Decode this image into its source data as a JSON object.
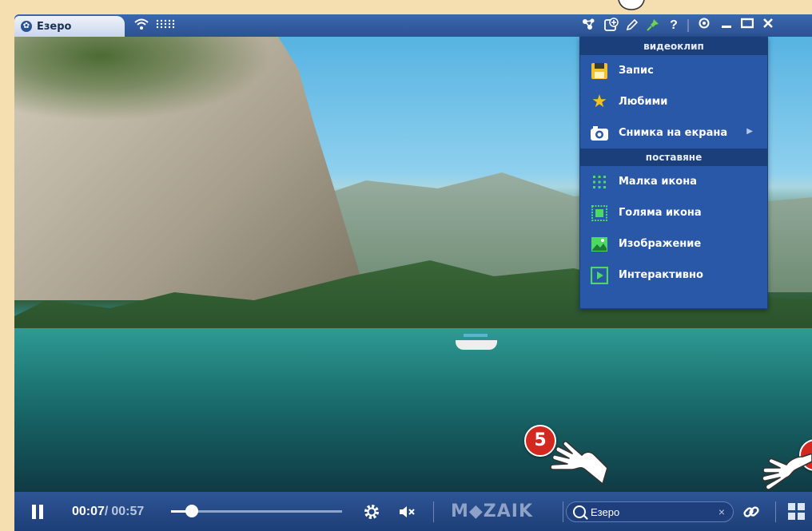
{
  "window": {
    "tab_title": "Езеро"
  },
  "titlebar_icons": [
    "molecule-icon",
    "add-resource-icon",
    "pencil-icon",
    "pin-icon",
    "help-icon",
    "eye-icon",
    "minimize-icon",
    "maximize-icon",
    "close-icon"
  ],
  "menu": {
    "section_video": "видеоклип",
    "section_embed": "поставяне",
    "items_video": [
      {
        "label": "Запис",
        "icon": "save-icon"
      },
      {
        "label": "Любими",
        "icon": "star-icon"
      },
      {
        "label": "Снимка на екрана",
        "icon": "camera-icon",
        "has_submenu": true
      }
    ],
    "items_embed": [
      {
        "label": "Малка икона",
        "icon": "small-icon-icon"
      },
      {
        "label": "Голяма икона",
        "icon": "large-icon-icon"
      },
      {
        "label": "Изображение",
        "icon": "image-icon"
      },
      {
        "label": "Интерактивно",
        "icon": "interactive-play-icon"
      }
    ]
  },
  "callouts": [
    {
      "number": "5"
    }
  ],
  "player": {
    "current_time": "00:07",
    "separator": "/",
    "total_time": "00:57",
    "progress": 0.12,
    "brand": "M◆ZAIK",
    "search_value": "Езеро",
    "search_clear": "×"
  },
  "colors": {
    "background": "#f5deb0",
    "titlebar": "#2b5294",
    "menu_bg": "#2a58a8",
    "menu_header": "#1b3f7a",
    "bottombar": "#1d3e78",
    "badge": "#d3281f"
  }
}
